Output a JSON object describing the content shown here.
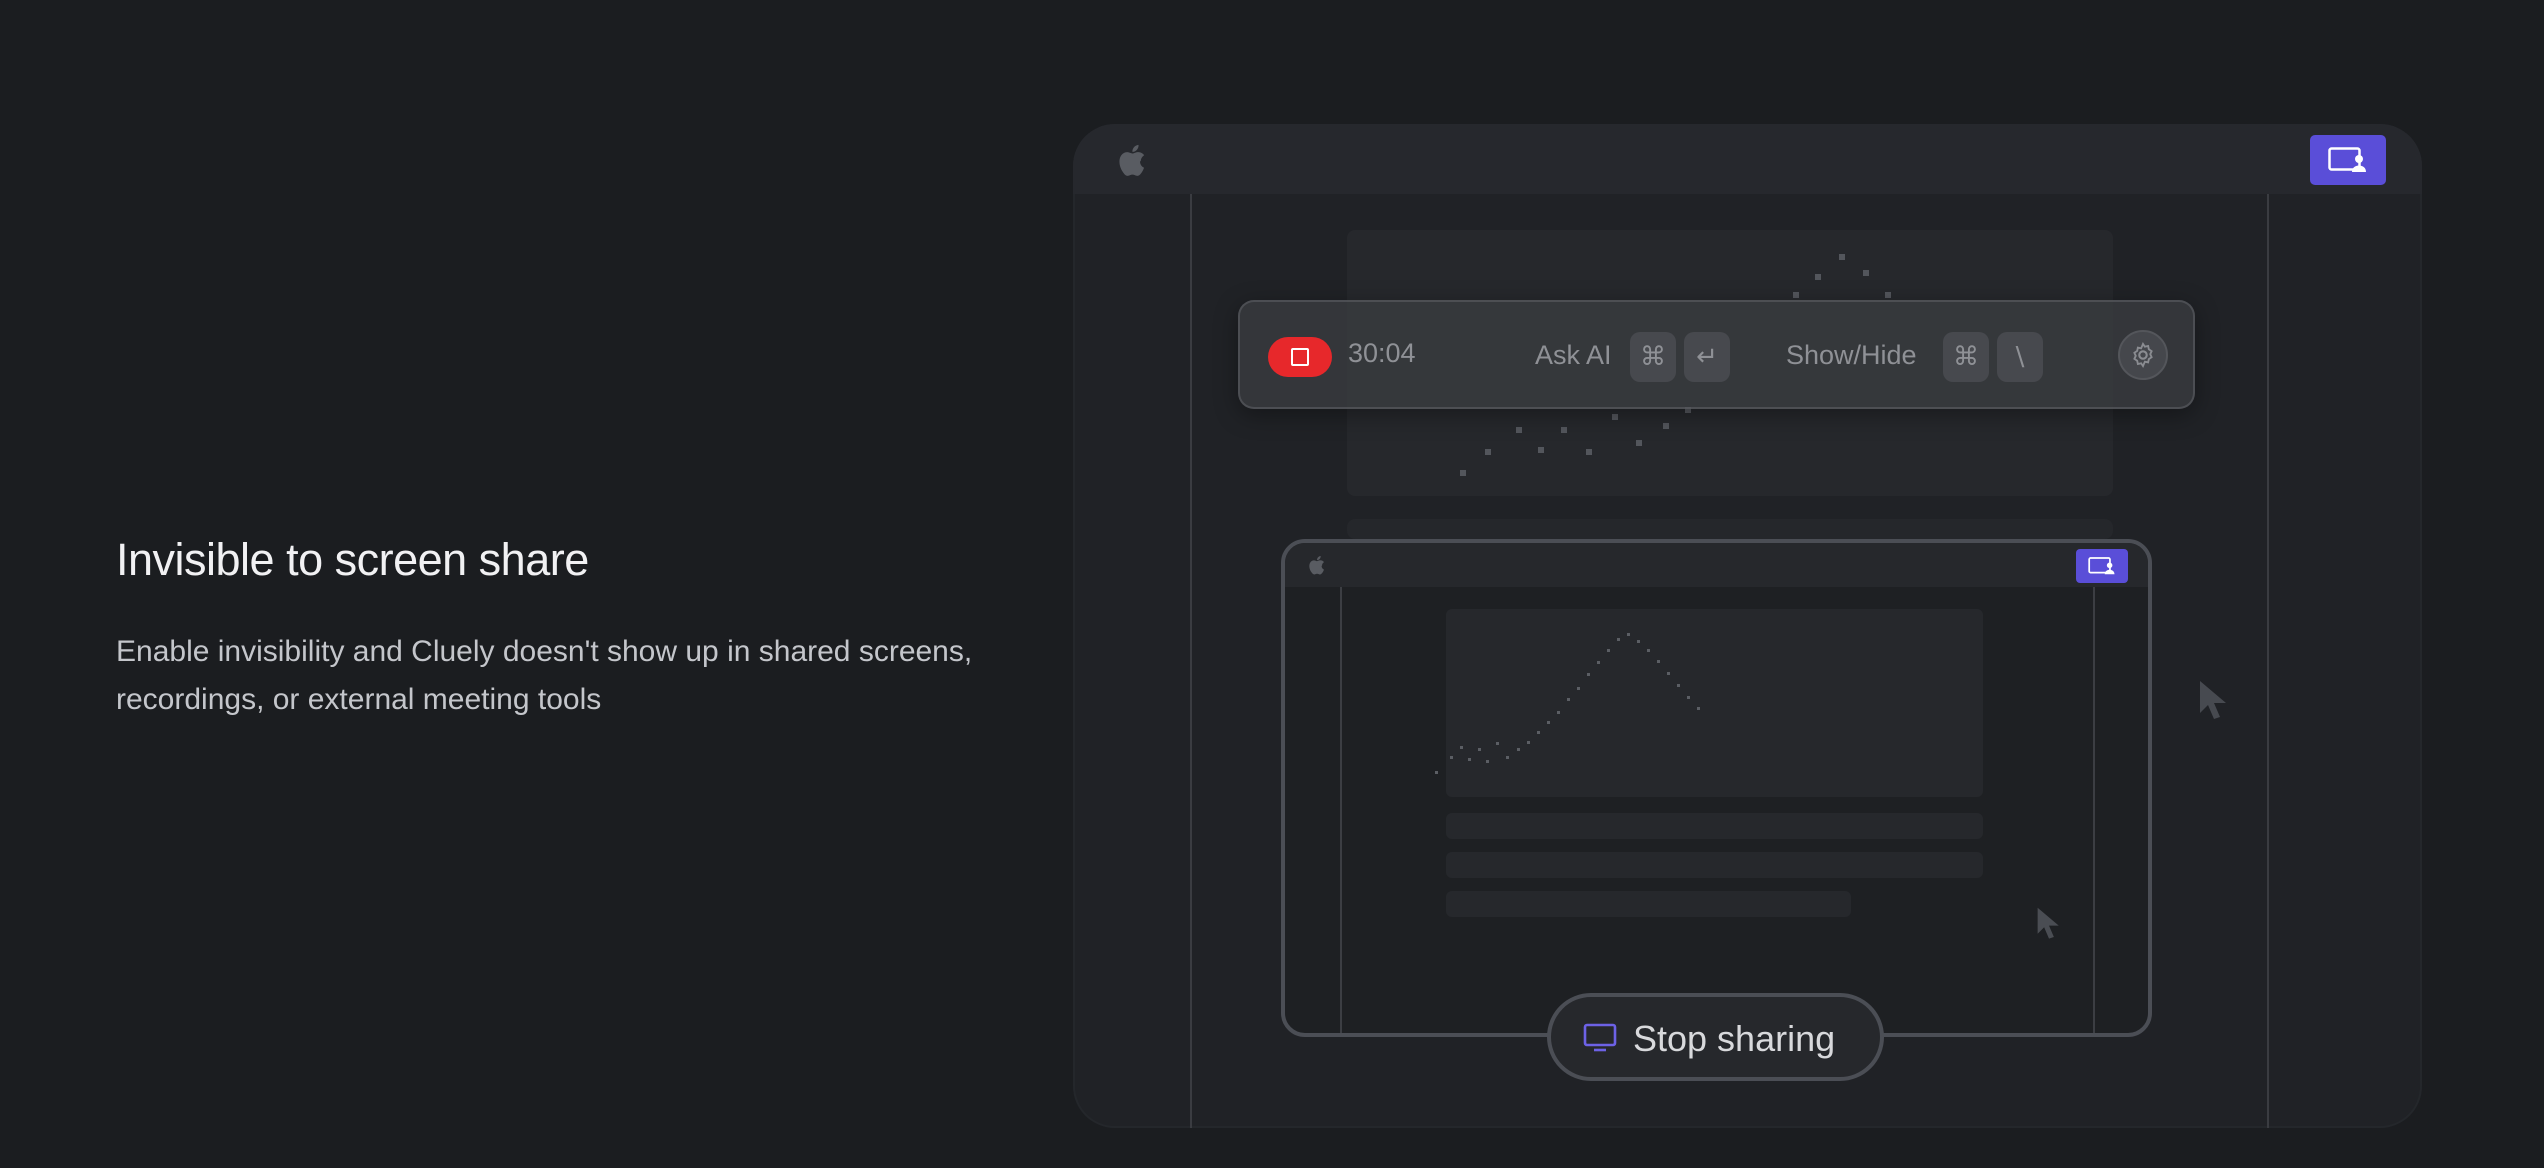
{
  "hero": {
    "title": "Invisible to screen share",
    "description": "Enable invisibility and Cluely doesn't show up in shared screens, recordings, or external meeting tools"
  },
  "toolbar": {
    "timer": "30:04",
    "ask_ai_label": "Ask AI",
    "ask_ai_keys": [
      "⌘",
      "↵"
    ],
    "show_hide_label": "Show/Hide",
    "show_hide_keys": [
      "⌘",
      "\\"
    ]
  },
  "stop_sharing": {
    "label": "Stop sharing"
  },
  "colors": {
    "background": "#1b1d20",
    "accent": "#5a4ed8",
    "record": "#e7282b"
  },
  "icons": [
    "apple-icon",
    "screen-share-icon",
    "stop-icon",
    "gear-icon",
    "cursor-icon",
    "monitor-icon"
  ]
}
